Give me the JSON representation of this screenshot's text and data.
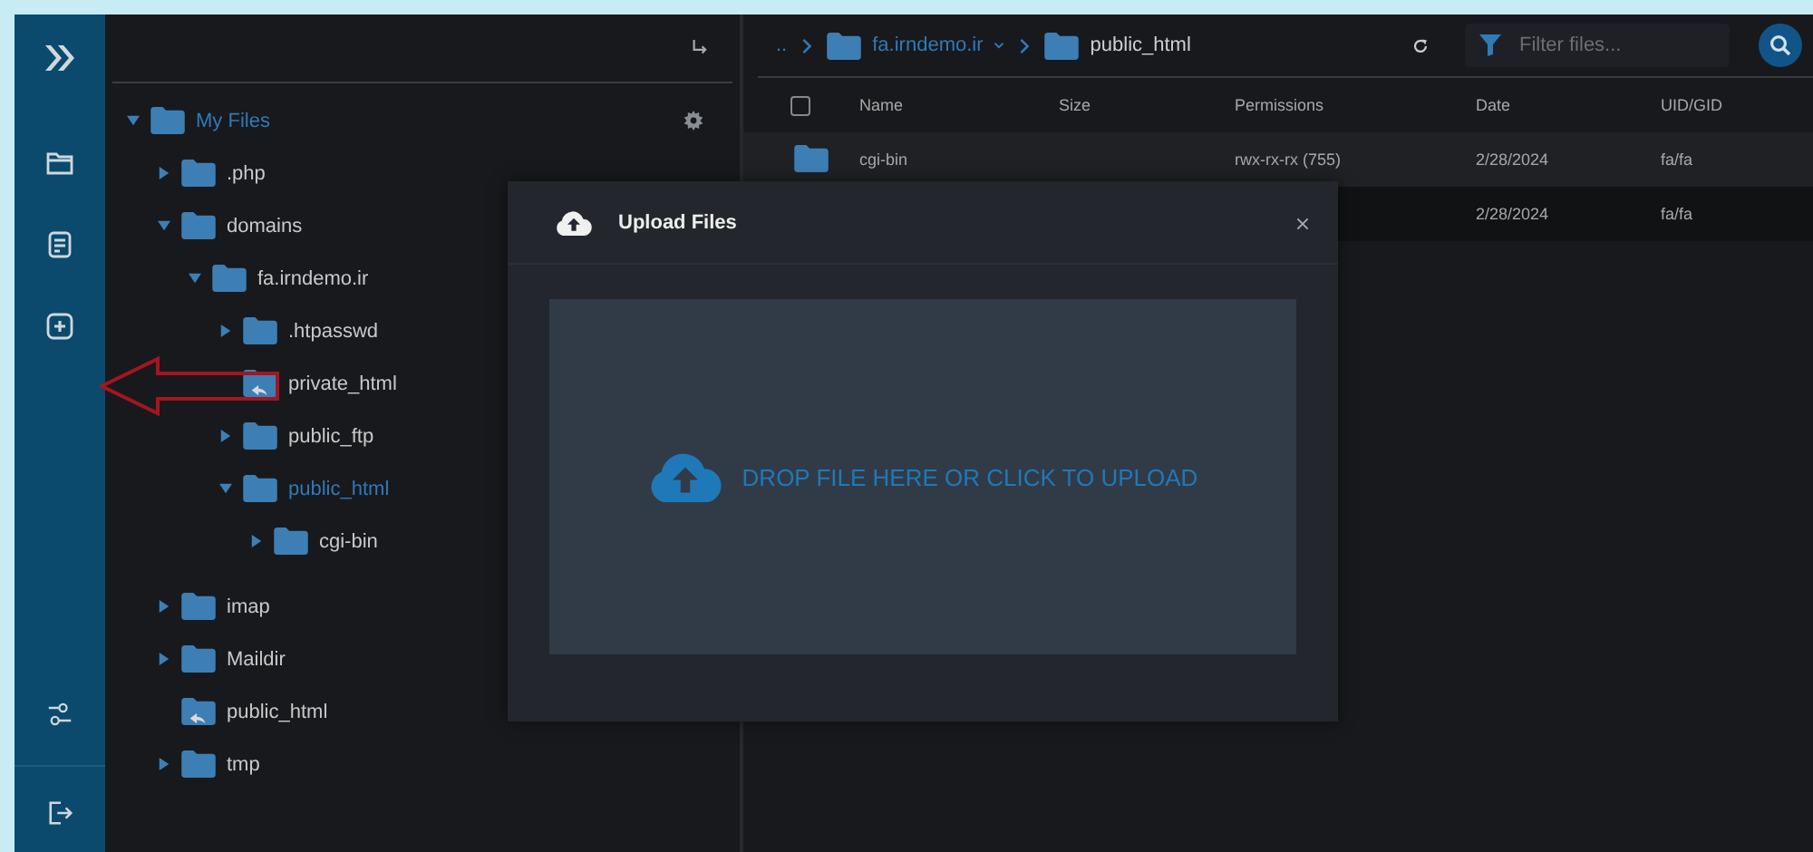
{
  "tree": {
    "root": {
      "label": "My Files",
      "expanded": true,
      "children": [
        {
          "label": ".php",
          "kind": "folder",
          "expanded": false,
          "selected": false
        },
        {
          "label": "domains",
          "kind": "folder",
          "expanded": true,
          "selected": false,
          "children": [
            {
              "label": "fa.irndemo.ir",
              "kind": "folder",
              "expanded": true,
              "selected": false,
              "children": [
                {
                  "label": ".htpasswd",
                  "kind": "folder",
                  "expanded": false,
                  "selected": false
                },
                {
                  "label": "private_html",
                  "kind": "link",
                  "selected": false
                },
                {
                  "label": "public_ftp",
                  "kind": "folder",
                  "expanded": false,
                  "selected": false
                },
                {
                  "label": "public_html",
                  "kind": "folder",
                  "expanded": true,
                  "selected": true,
                  "children": [
                    {
                      "label": "cgi-bin",
                      "kind": "folder",
                      "expanded": false,
                      "selected": false
                    }
                  ]
                }
              ]
            }
          ]
        },
        {
          "label": "imap",
          "kind": "folder",
          "expanded": false,
          "selected": false
        },
        {
          "label": "Maildir",
          "kind": "folder",
          "expanded": false,
          "selected": false
        },
        {
          "label": "public_html",
          "kind": "link",
          "selected": false
        },
        {
          "label": "tmp",
          "kind": "folder",
          "expanded": false,
          "selected": false
        }
      ]
    }
  },
  "breadcrumb": [
    {
      "label": "..",
      "kind": "parent"
    },
    {
      "label": "fa.irndemo.ir",
      "kind": "dropdown"
    },
    {
      "label": "public_html",
      "kind": "current"
    }
  ],
  "filter": {
    "placeholder": "Filter files..."
  },
  "table": {
    "columns": [
      "Name",
      "Size",
      "Permissions",
      "Date",
      "UID/GID"
    ],
    "select_all": {
      "checked": false
    },
    "rows": [
      {
        "kind": "folder",
        "name": "cgi-bin",
        "permissions": "rwx-rx-rx (755)",
        "date": "2/28/2024",
        "uid_gid": "fa/fa",
        "selected": false
      },
      {
        "kind": "covered",
        "date": "2/28/2024",
        "uid_gid": "fa/fa",
        "selected": true
      }
    ]
  },
  "dialog": {
    "title": "Upload Files",
    "dropzone": "DROP FILE HERE OR CLICK TO UPLOAD"
  }
}
